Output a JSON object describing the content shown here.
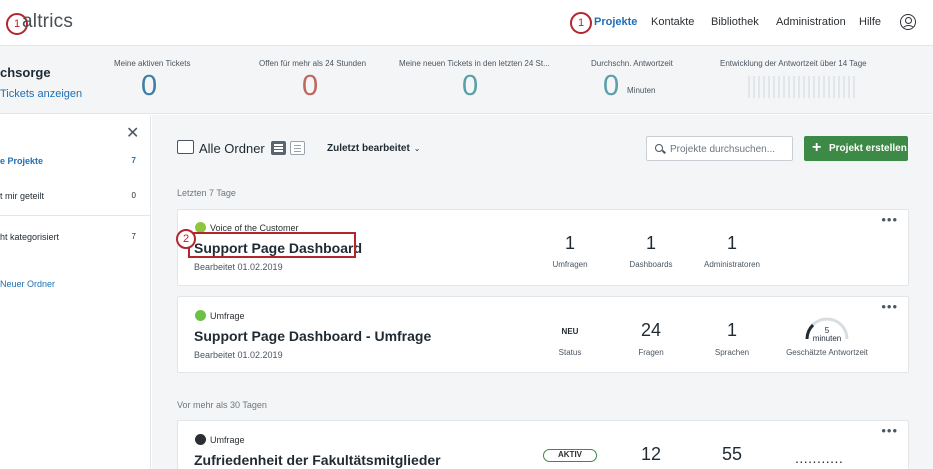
{
  "nav": {
    "logo": "altrics",
    "callout_logo": "1",
    "callout_projects": "1",
    "items": [
      "Projekte",
      "Kontakte",
      "Bibliothek",
      "Administration",
      "Hilfe"
    ]
  },
  "stats": {
    "title": "chsorge",
    "link": "Tickets anzeigen",
    "items": [
      {
        "label": "Meine aktiven Tickets",
        "value": "0",
        "color": "#3f7fa6"
      },
      {
        "label": "Offen für mehr als 24 Stunden",
        "value": "0",
        "color": "#c0675d"
      },
      {
        "label": "Meine neuen Tickets in den letzten 24 St...",
        "value": "0",
        "color": "#5a9fa9"
      },
      {
        "label": "Durchschn. Antwortzeit",
        "value": "0",
        "color": "#5a9fa9",
        "unit": "Minuten"
      },
      {
        "label": "Entwicklung der Antwortzeit über 14 Tage"
      }
    ]
  },
  "sidebar": {
    "items": [
      {
        "label": "e Projekte",
        "count": "7"
      },
      {
        "label": "t mir geteilt",
        "count": "0"
      },
      {
        "label": "ht kategorisiert",
        "count": "7"
      }
    ],
    "new_folder": "Neuer Ordner"
  },
  "toolbar": {
    "folder_title": "Alle Ordner",
    "sort_label": "Zuletzt bearbeitet",
    "search_placeholder": "Projekte durchsuchen...",
    "create_label": "Projekt erstellen"
  },
  "sections": {
    "recent": "Letzten 7 Tage",
    "older": "Vor mehr als 30 Tagen"
  },
  "cards": [
    {
      "type": "Voice of the Customer",
      "title": "Support Page Dashboard",
      "edited": "Bearbeitet 01.02.2019",
      "callout": "2",
      "metrics": [
        {
          "value": "1",
          "label": "Umfragen"
        },
        {
          "value": "1",
          "label": "Dashboards"
        },
        {
          "value": "1",
          "label": "Administratoren"
        }
      ]
    },
    {
      "type": "Umfrage",
      "title": "Support Page Dashboard - Umfrage",
      "edited": "Bearbeitet 01.02.2019",
      "metrics": [
        {
          "value": "NEU",
          "label": "Status"
        },
        {
          "value": "24",
          "label": "Fragen"
        },
        {
          "value": "1",
          "label": "Sprachen"
        },
        {
          "value": "5",
          "unit": "minuten",
          "label": "Geschätzte Antwortzeit"
        }
      ]
    },
    {
      "type": "Umfrage",
      "title": "Zufriedenheit der Fakultätsmitglieder",
      "metrics": [
        {
          "value": "AKTIV"
        },
        {
          "value": "12"
        },
        {
          "value": "55"
        },
        {
          "value": "..........."
        }
      ]
    }
  ],
  "colors": {
    "accent": "#1e6fb5",
    "callout": "#b4262e",
    "create_button": "#3c8a45",
    "voc_icon": "#8dc63f",
    "survey_icon": "#6cc04a",
    "dark_icon": "#2b2f33"
  }
}
